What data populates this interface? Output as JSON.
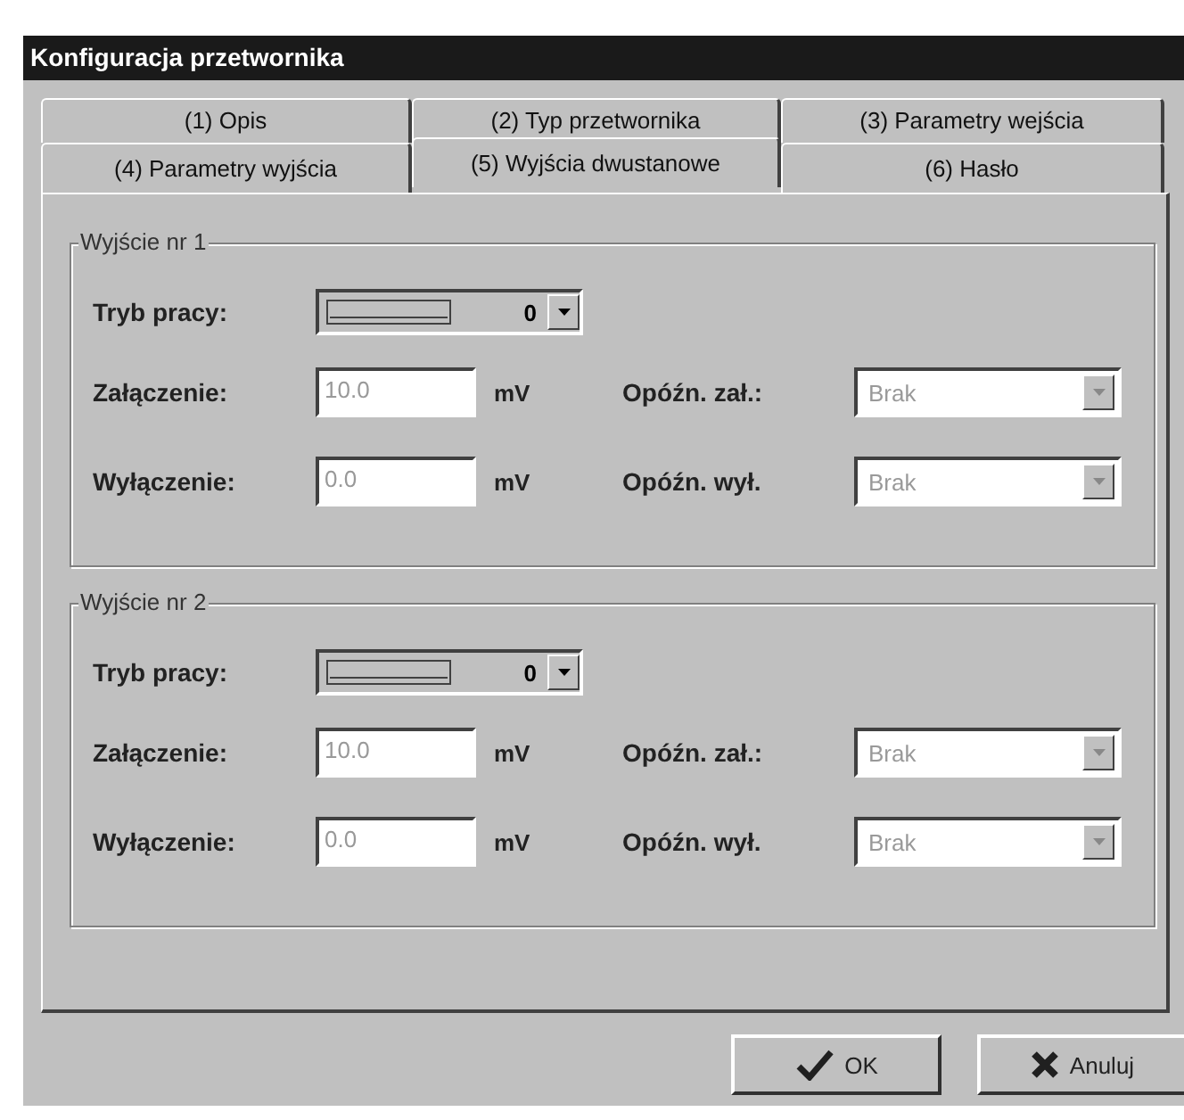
{
  "window": {
    "title": "Konfiguracja przetwornika"
  },
  "tab_rows": [
    {
      "tabs": [
        {
          "label": "(1) Opis",
          "selected": false
        },
        {
          "label": "(2) Typ przetwornika",
          "selected": false
        },
        {
          "label": "(3) Parametry wejścia",
          "selected": false
        }
      ]
    },
    {
      "tabs": [
        {
          "label": "(4) Parametry wyjścia",
          "selected": false
        },
        {
          "label": "(5) Wyjścia dwustanowe",
          "selected": true
        },
        {
          "label": "(6) Hasło",
          "selected": false
        }
      ]
    }
  ],
  "outputs": [
    {
      "title": "Wyjście nr 1",
      "mode": {
        "label": "Tryb pracy:",
        "value": "0"
      },
      "rows": [
        {
          "label": "Załączenie:",
          "value": "10.0",
          "unit": "mV",
          "disabled": true,
          "delay": {
            "label": "Opóźn. zał.:",
            "value": "Brak",
            "disabled": true
          }
        },
        {
          "label": "Wyłączenie:",
          "value": "0.0",
          "unit": "mV",
          "disabled": true,
          "delay": {
            "label": "Opóźn. wył.",
            "value": "Brak",
            "disabled": true
          }
        }
      ]
    },
    {
      "title": "Wyjście nr 2",
      "mode": {
        "label": "Tryb pracy:",
        "value": "0"
      },
      "rows": [
        {
          "label": "Załączenie:",
          "value": "10.0",
          "unit": "mV",
          "disabled": true,
          "delay": {
            "label": "Opóźn. zał.:",
            "value": "Brak",
            "disabled": true
          }
        },
        {
          "label": "Wyłączenie:",
          "value": "0.0",
          "unit": "mV",
          "disabled": true,
          "delay": {
            "label": "Opóźn. wył.",
            "value": "Brak",
            "disabled": true
          }
        }
      ]
    }
  ],
  "buttons": [
    {
      "kind": "ok",
      "label": "OK"
    },
    {
      "kind": "cancel",
      "label": "Anuluj"
    }
  ]
}
